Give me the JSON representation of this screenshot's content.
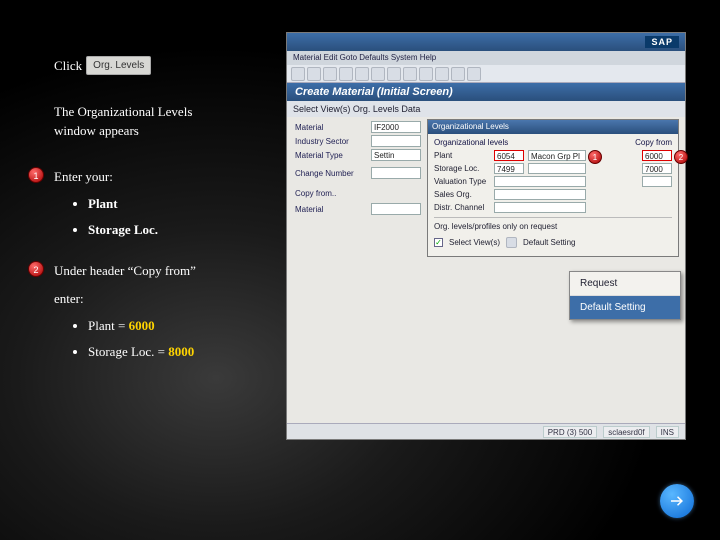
{
  "instructions": {
    "click_prefix": "Click",
    "org_button_label": "Org. Levels",
    "appears_line1": "The Organizational Levels",
    "appears_line2": "window appears",
    "step1_intro": "Enter your:",
    "step1_items": {
      "a": "Plant",
      "b": "Storage Loc."
    },
    "step2_intro": "Under header “Copy from”",
    "step2_enter": "enter:",
    "step2_items": {
      "a_label": "Plant = ",
      "a_value": "6000",
      "b_label": "Storage Loc. = ",
      "b_value": "8000"
    },
    "badge1": "1",
    "badge2": "2"
  },
  "sap": {
    "menubar": "Material  Edit  Goto  Defaults  System  Help",
    "logo": "SAP",
    "heading": "Create Material (Initial Screen)",
    "subbar": "Select View(s)   Org. Levels   Data",
    "form": {
      "material": {
        "label": "Material",
        "value": "IF2000"
      },
      "industry": {
        "label": "Industry Sector",
        "value": ""
      },
      "mtype": {
        "label": "Material Type",
        "value": "Settin"
      },
      "change": {
        "label": "Change Number",
        "value": ""
      },
      "copyfrom": {
        "label": "Copy from..",
        "value": ""
      },
      "material2": {
        "label": "Material",
        "value": ""
      }
    },
    "org_dialog": {
      "title": "Organizational Levels",
      "heading_left": "Organizational levels",
      "heading_right": "Copy from",
      "rows": {
        "plant": {
          "label": "Plant",
          "v1": "6054",
          "v1b": "Macon Grp Pl",
          "v2": "6000"
        },
        "storage": {
          "label": "Storage Loc.",
          "v1": "7499",
          "v2": "7000"
        },
        "valtype": {
          "label": "Valuation Type",
          "v1": "",
          "v2": ""
        },
        "salesorg": {
          "label": "Sales Org.",
          "v1": "",
          "v2": ""
        },
        "distch": {
          "label": "Distr. Channel",
          "v1": "",
          "v2": ""
        }
      },
      "only_main": "Org. levels/profiles only on request",
      "select_views": "Select View(s)",
      "default": "Default Setting"
    },
    "popup": {
      "item1": "Request",
      "item2": "Default Setting"
    },
    "callouts": {
      "c1": "1",
      "c2": "2"
    },
    "status": {
      "a": "PRD (3) 500",
      "b": "sclaesrd0f",
      "c": "INS"
    }
  },
  "nav": {
    "next": "next"
  }
}
